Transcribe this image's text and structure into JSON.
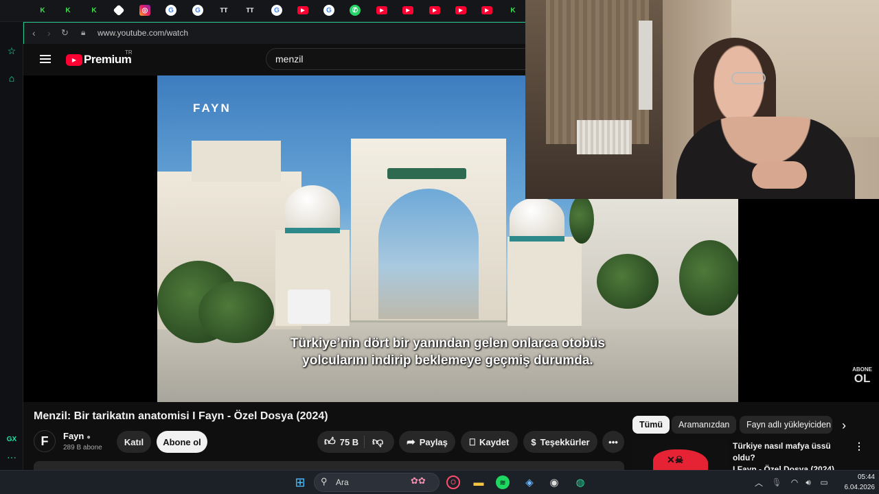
{
  "browser": {
    "url": "www.youtube.com/watch",
    "tabs": [
      "opera",
      "k",
      "k",
      "k",
      "app",
      "instagram",
      "google",
      "google",
      "tiktok",
      "tiktok",
      "google",
      "youtube",
      "google",
      "whatsapp",
      "youtube",
      "youtube",
      "youtube",
      "youtube",
      "youtube",
      "k"
    ],
    "sidebar_label_gx": "GX"
  },
  "youtube": {
    "logo_text": "Premium",
    "region": "TR",
    "search_value": "menzil",
    "video": {
      "watermark": "FAYN",
      "subtitle_line1": "Türkiye’nin dört bir yanından gelen onlarca otobüs",
      "subtitle_line2": "yolcularını indirip beklemeye geçmiş durumda.",
      "subscribe_overlay_top": "ABONE",
      "subscribe_overlay_bottom": "OL"
    },
    "title": "Menzil: Bir tarikatın anatomisi I Fayn - Özel Dosya (2024)",
    "channel": {
      "name": "Fayn",
      "subscribers": "289 B abone",
      "join_label": "Katıl",
      "subscribe_label": "Abone ol"
    },
    "actions": {
      "likes": "75 B",
      "share": "Paylaş",
      "save": "Kaydet",
      "thanks": "Teşekkürler"
    },
    "filter_chips": [
      "Tümü",
      "Aramanızdan",
      "Fayn adlı yükleyiciden"
    ],
    "recommended": {
      "title_line1": "Türkiye nasıl mafya üssü oldu?",
      "title_line2": "I Fayn - Özel Dosya (2024)"
    }
  },
  "taskbar": {
    "search_label": "Ara",
    "time": "05:44",
    "date": "6.04.2026"
  },
  "colors": {
    "youtube_red": "#ff0033",
    "gx_accent": "#21e6a3",
    "chip_active_bg": "#f1f1f1"
  }
}
